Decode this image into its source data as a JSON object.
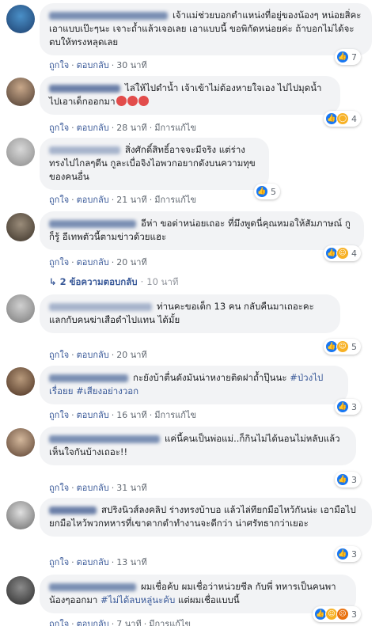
{
  "comments": [
    {
      "text": "เจ้าแม่ช่วยบอกตำแหน่งที่อยู่ของน้องๆ หน่อยสิ่คะ เอาแบบเป๊ะๆนะ เจาะถ้ำแล้วเจอเลย เอาแบบนี้ ขอพิกัดหน่อยค่ะ ถ้าบอกไม่ได้จะตบให้ทรงหลุดเลย",
      "like": "ถูกใจ",
      "reply": "ตอบกลับ",
      "time": "30 นาที",
      "edited": "",
      "reactions": [
        "like"
      ],
      "count": "7"
    },
    {
      "text": "ไล่ให้ไปดำน้ำ เจ้าเข้าไม่ต้องหายใจเอง ไปไปมุดน้ำไปเอาเด็กออกมา",
      "like": "ถูกใจ",
      "reply": "ตอบกลับ",
      "time": "28 นาที",
      "edited": "มีการแก้ไข",
      "reactions": [
        "like",
        "wow"
      ],
      "count": "4"
    },
    {
      "text": "สิ่งศักดิ์สิทธิ์อาจจะมีจริง แต่ร่างทรงไปไกลๆตีน กูละเบื่อจิงไอพวกอยากดังบนความทุขของคนอื่น",
      "like": "ถูกใจ",
      "reply": "ตอบกลับ",
      "time": "21 นาที",
      "edited": "มีการแก้ไข",
      "reactions": [
        "like"
      ],
      "count": "5"
    },
    {
      "text": "อีห่า ขอด่าหน่อยเถอะ ที่มึงพูดนี่คุณหมอให้สัมภาษณ์ กูก็รู้ อีเทพตัวนี้ตามข่าวด้วยแฮะ",
      "like": "ถูกใจ",
      "reply": "ตอบกลับ",
      "time": "20 นาที",
      "edited": "",
      "reactions": [
        "like",
        "haha"
      ],
      "count": "4"
    },
    {
      "text": "ท่านคะขอเด็ก 13 คน กลับคืนมาเถอะคะ แลกกับคนฆ่าเสือดำไปแทน ได้มั้ย",
      "like": "ถูกใจ",
      "reply": "ตอบกลับ",
      "time": "20 นาที",
      "edited": "",
      "reactions": [
        "like",
        "haha"
      ],
      "count": "5"
    },
    {
      "text": "กะยังบ้าตื่นดังมันน่าหงายติดฝาถ้ำปุ๊นนะ ",
      "hashtags": [
        "#ป่วงไปเรื่อยย",
        "#เสียงอย่างวอก"
      ],
      "like": "ถูกใจ",
      "reply": "ตอบกลับ",
      "time": "16 นาที",
      "edited": "มีการแก้ไข",
      "reactions": [
        "like"
      ],
      "count": "3"
    },
    {
      "text": "แค่นี้คนเป็นพ่อแม่..ก็กินไม่ได้นอนไม่หลับแล้ว เห็นใจกันบ้างเถอะ!!",
      "like": "ถูกใจ",
      "reply": "ตอบกลับ",
      "time": "31 นาที",
      "edited": "",
      "reactions": [
        "like"
      ],
      "count": "3"
    },
    {
      "text": "สปริงนิวส์ลงคลิป ร่างทรงบ้าบอ แล้วไล่ทียกมือไหว้กันน่ะ เอามือไปยกมือไหว้พวกทหารที่เขาตากตำทำงานจะดีกว่า น่าศรัทธากว่าเยอะ",
      "like": "ถูกใจ",
      "reply": "ตอบกลับ",
      "time": "13 นาที",
      "edited": "",
      "reactions": [
        "like"
      ],
      "count": "3"
    },
    {
      "text": "ผมเชื่อค้บ ผมเชื่อว่าหน่วยซีล กับพี่ ทหารเป็นคนพาน้องๆออกมา ",
      "hashtags": [
        "#ไม่ได้ลบหลู่นะค้บ"
      ],
      "text_after": " แต่ผมเชื่อแบบนี้",
      "like": "ถูกใจ",
      "reply": "ตอบกลับ",
      "time": "7 นาที",
      "edited": "มีการแก้ไข",
      "reactions": [
        "like",
        "haha",
        "angry"
      ],
      "count": "3"
    }
  ],
  "replies_link": {
    "label": "2 ข้อความตอบกลับ",
    "time": "10 นาที"
  },
  "colors": {
    "link": "#385898",
    "bubble": "#f2f3f5",
    "like": "#1877f2"
  }
}
